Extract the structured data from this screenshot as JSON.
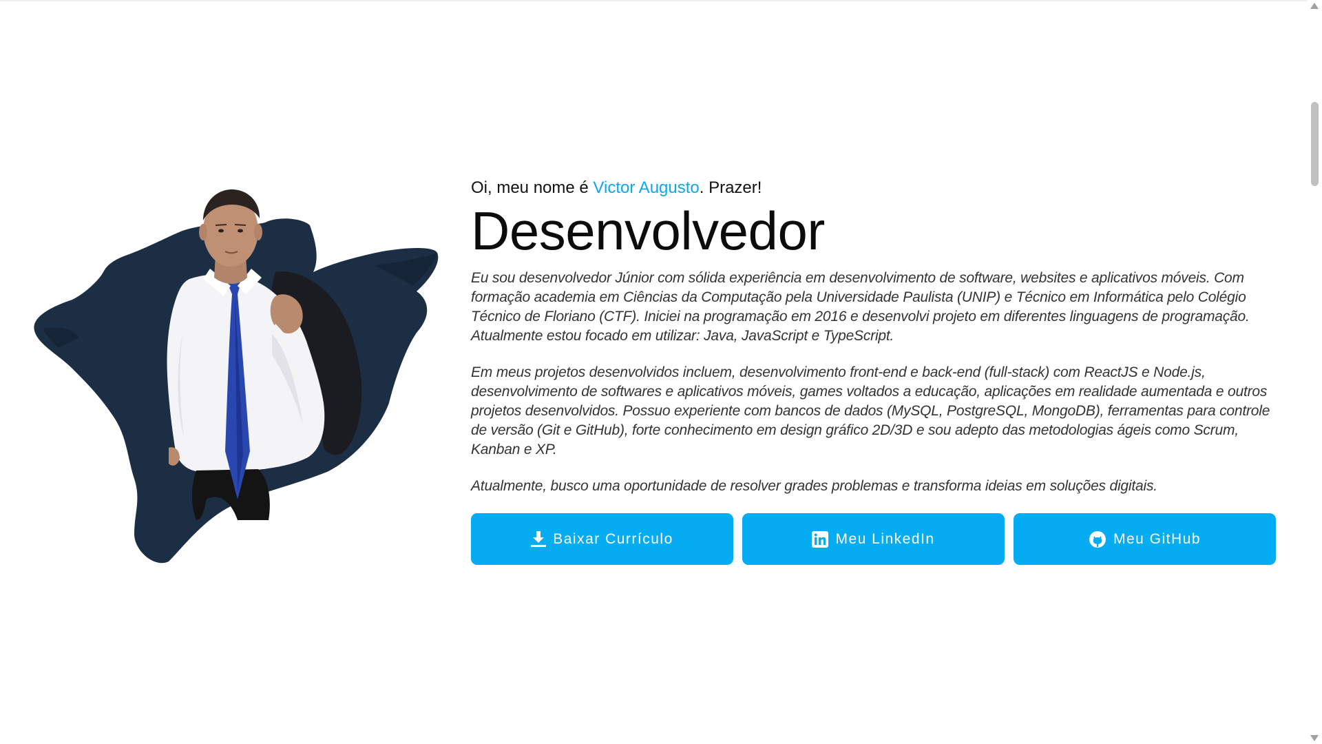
{
  "hero": {
    "greeting_prefix": "Oi, meu nome é ",
    "name": "Victor Augusto",
    "greeting_suffix": ". Prazer!",
    "headline": "Desenvolvedor",
    "paragraphs": [
      "Eu sou desenvolvedor Júnior com sólida experiência em desenvolvimento de software, websites e aplicativos móveis. Com formação academia em Ciências da Computação pela Universidade Paulista (UNIP) e Técnico em Informática pelo Colégio Técnico de Floriano (CTF). Iniciei na programação em 2016 e desenvolvi projeto em diferentes linguagens de programação. Atualmente estou focado em utilizar: Java, JavaScript e TypeScript.",
      "Em meus projetos desenvolvidos incluem, desenvolvimento front-end e back-end (full-stack) com ReactJS e Node.js, desenvolvimento de softwares e aplicativos móveis, games voltados a educação, aplicações em realidade aumentada e outros projetos desenvolvidos. Possuo experiente com bancos de dados (MySQL, PostgreSQL, MongoDB), ferramentas para controle de versão (Git e GitHub), forte conhecimento em design gráfico 2D/3D e sou adepto das metodologias ágeis como Scrum, Kanban e XP.",
      "Atualmente, busco uma oportunidade de resolver grades problemas e transforma ideias em soluções digitais."
    ],
    "buttons": [
      {
        "label": "Baixar Currículo",
        "icon": "download-icon"
      },
      {
        "label": "Meu LinkedIn",
        "icon": "linkedin-icon"
      },
      {
        "label": "Meu GitHub",
        "icon": "github-icon"
      }
    ]
  },
  "colors": {
    "accent": "#05acf1",
    "name_highlight": "#0aa8f0",
    "brush_stroke": "#1c2e44",
    "tie": "#2a47b0"
  }
}
